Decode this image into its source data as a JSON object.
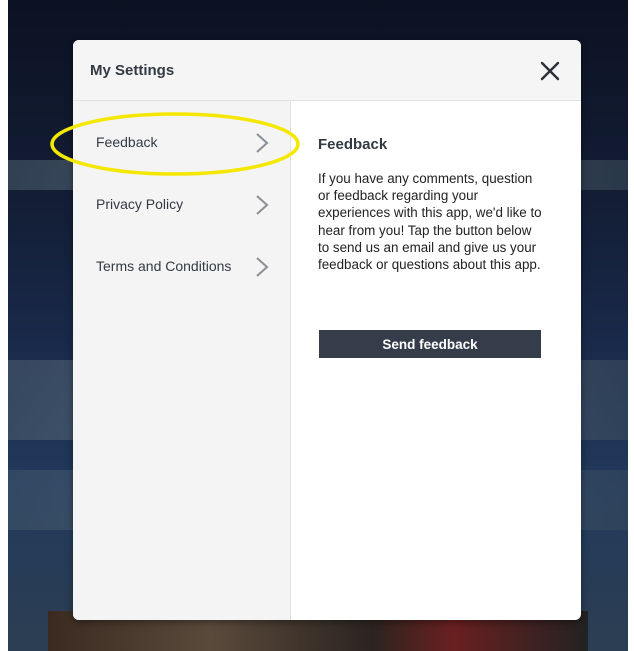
{
  "modal": {
    "title": "My Settings",
    "close_icon": "close-icon"
  },
  "sidebar": {
    "items": [
      {
        "label": "Feedback",
        "icon": "chevron-right-icon"
      },
      {
        "label": "Privacy Policy",
        "icon": "chevron-right-icon"
      },
      {
        "label": "Terms and Conditions",
        "icon": "chevron-right-icon"
      }
    ]
  },
  "content": {
    "title": "Feedback",
    "body": "If you have any comments, question or feedback regarding your experiences with this app, we'd like to hear from you! Tap the button below to send us an email and give us your feedback or questions about this app.",
    "button_label": "Send feedback"
  },
  "colors": {
    "highlight": "#f5e800",
    "button_bg": "#363d4a",
    "text": "#333a44"
  }
}
